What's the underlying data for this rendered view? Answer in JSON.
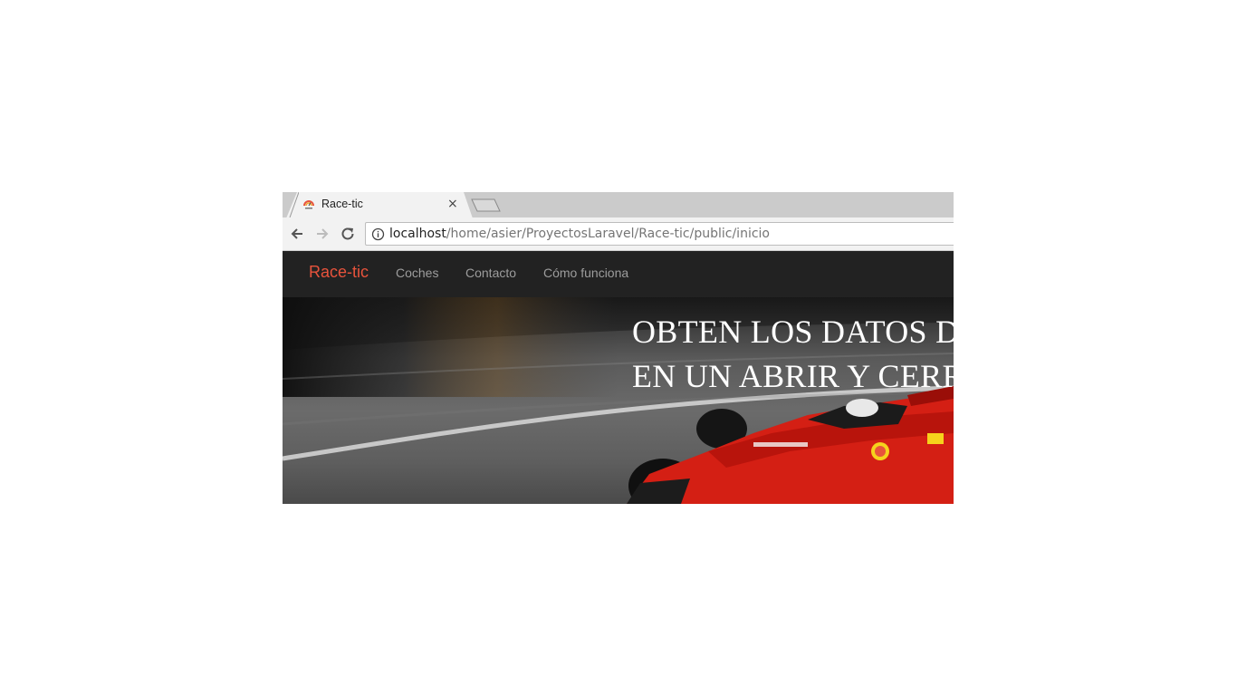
{
  "browser": {
    "tab": {
      "title": "Race-tic",
      "favicon": "race-tic-gauge-icon",
      "close_icon": "close-icon"
    },
    "newtab_icon": "new-tab-icon",
    "toolbar": {
      "back_icon": "arrow-left-icon",
      "forward_icon": "arrow-right-icon",
      "reload_icon": "reload-icon",
      "info_icon": "info-circle-icon",
      "url_host": "localhost",
      "url_path": "/home/asier/ProyectosLaravel/Race-tic/public/inicio"
    }
  },
  "site": {
    "navbar": {
      "brand": "Race-tic",
      "links": [
        "Coches",
        "Contacto",
        "Cómo funciona"
      ]
    },
    "hero": {
      "headline_line1": "OBTEN LOS DATOS D",
      "headline_line2": "EN UN ABRIR Y CERR"
    }
  },
  "colors": {
    "navbar_bg": "#222222",
    "brand": "#e8533c",
    "nav_link": "#9d9d9d",
    "headline": "#ffffff",
    "car_red": "#d41f14"
  }
}
